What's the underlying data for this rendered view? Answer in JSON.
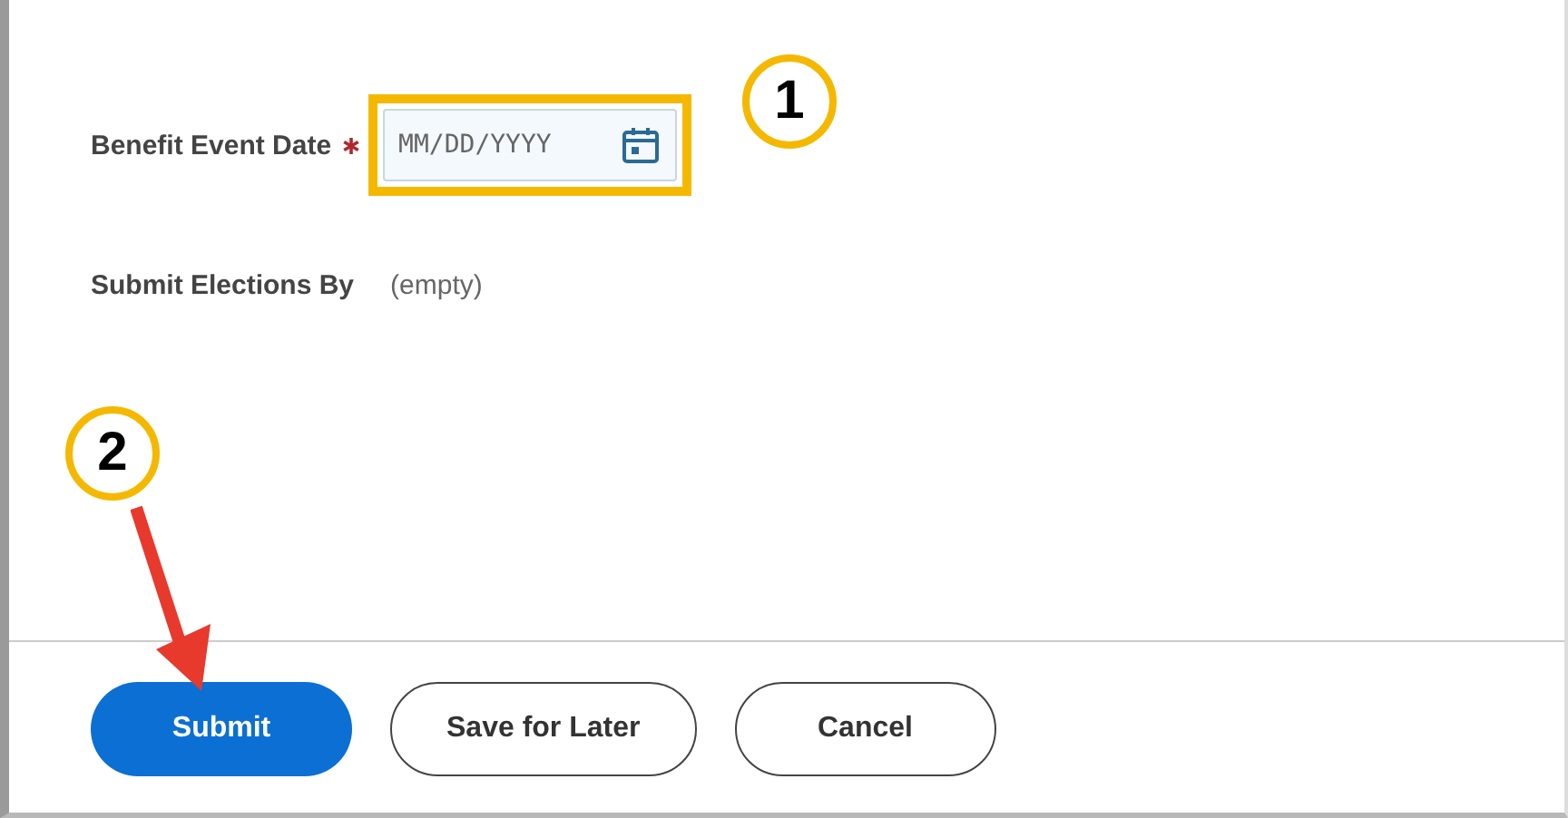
{
  "form": {
    "fields": [
      {
        "kind": "date",
        "label": "Benefit Event Date",
        "required": true,
        "placeholder": "MM/DD/YYYY",
        "highlighted": true
      },
      {
        "kind": "text",
        "label": "Submit Elections By",
        "required": false,
        "value": "(empty)",
        "highlighted": false
      }
    ]
  },
  "buttons": [
    {
      "label": "Submit",
      "kind": "primary"
    },
    {
      "label": "Save for Later",
      "kind": "secondary"
    },
    {
      "label": "Cancel",
      "kind": "secondary"
    }
  ],
  "callouts": [
    {
      "label": "1",
      "arrow": false
    },
    {
      "label": "2",
      "arrow": true
    }
  ]
}
